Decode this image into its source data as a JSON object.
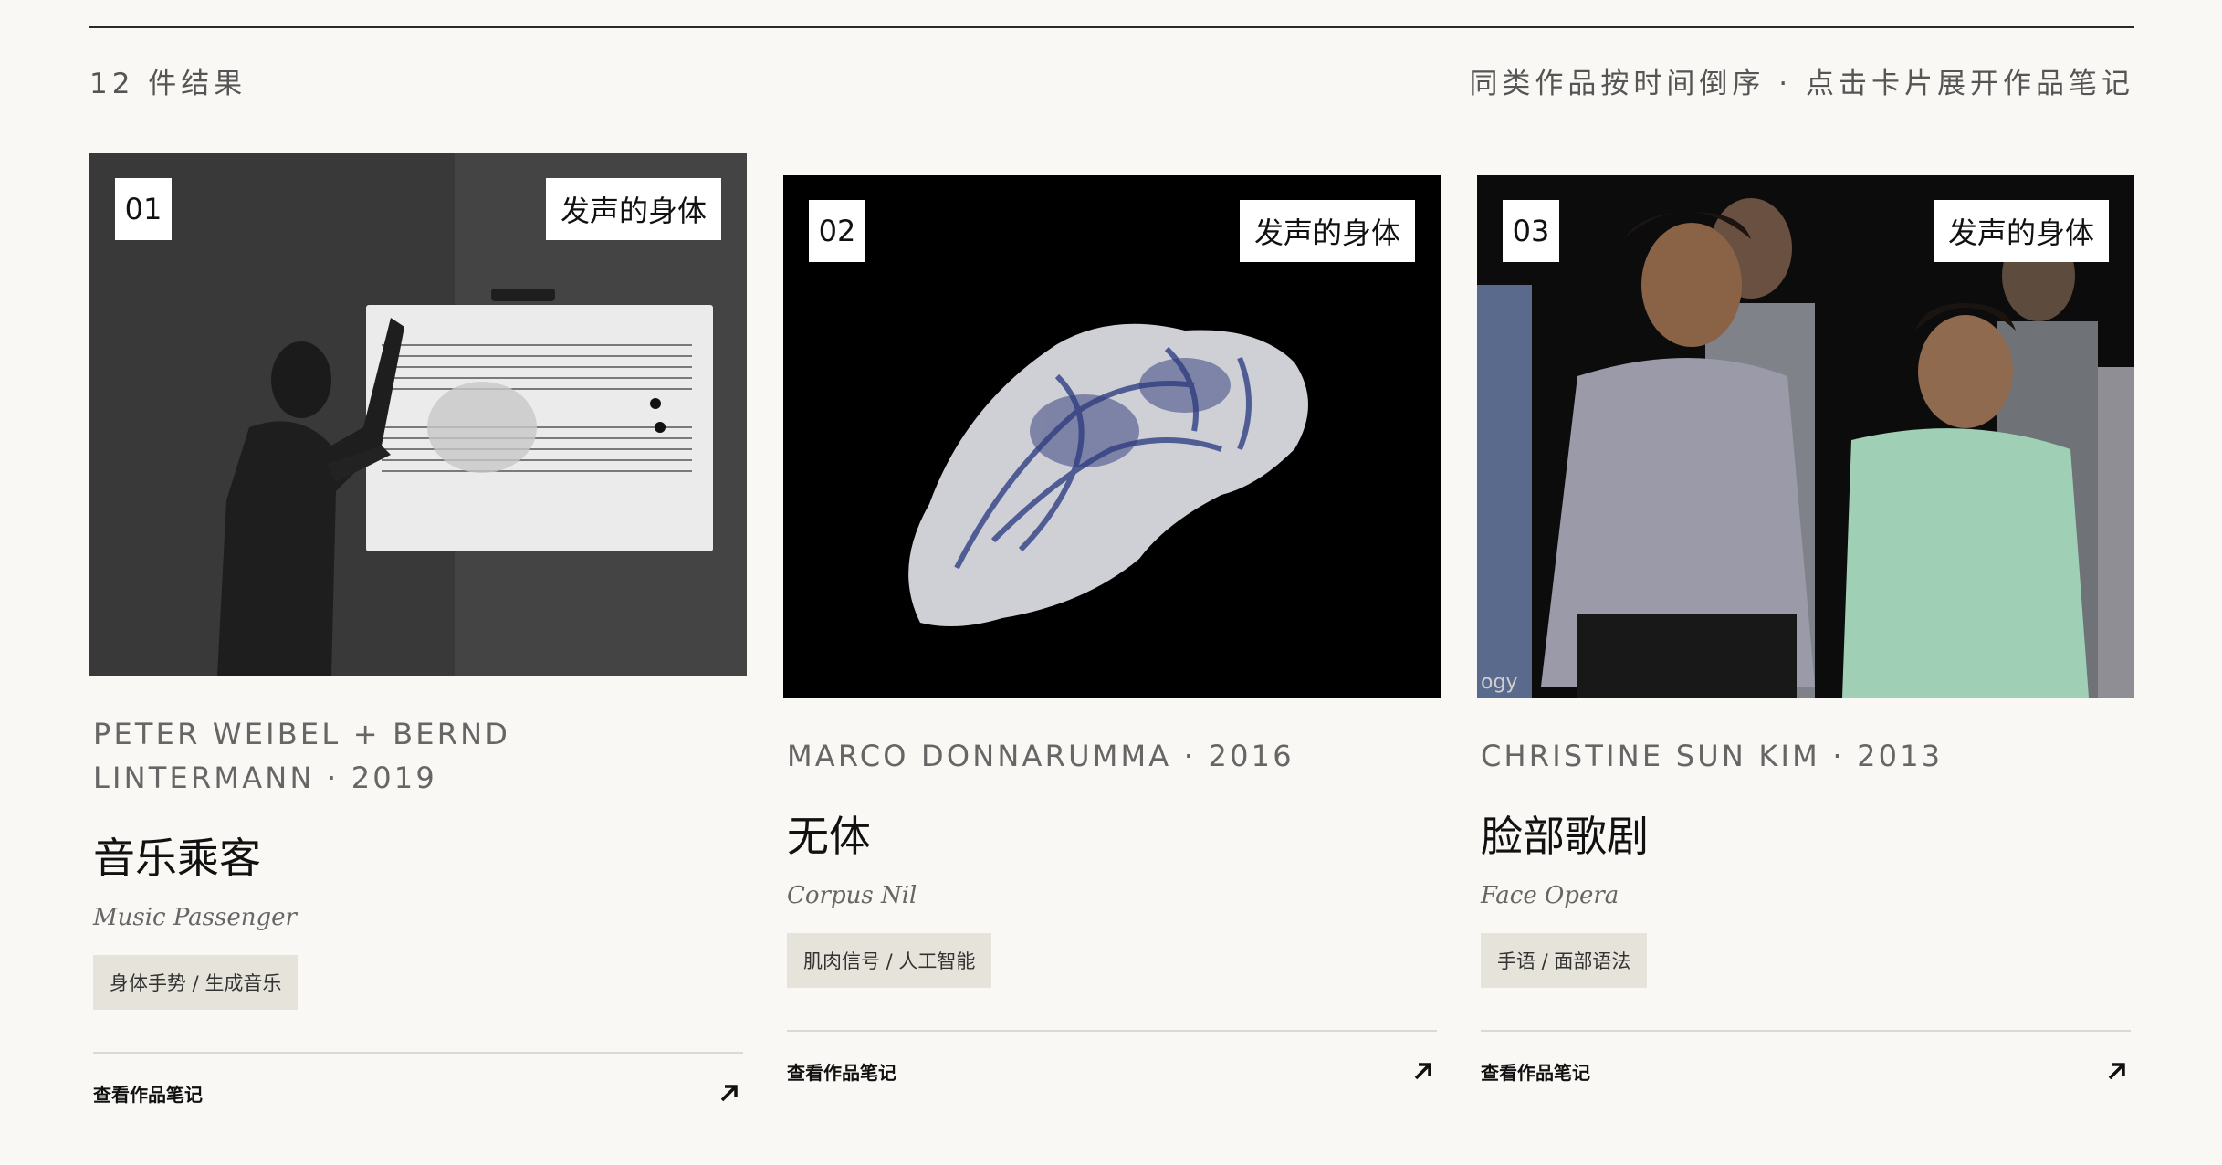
{
  "header": {
    "result_count": "12 件结果",
    "hint": "同类作品按时间倒序 · 点击卡片展开作品笔记"
  },
  "cards": [
    {
      "number": "01",
      "category": "发声的身体",
      "artist_line": "PETER WEIBEL + BERND LINTERMANN · 2019",
      "title": "音乐乘客",
      "title_en": "Music Passenger",
      "keywords": "身体手势 / 生成音乐",
      "cta": "查看作品笔记"
    },
    {
      "number": "02",
      "category": "发声的身体",
      "artist_line": "MARCO DONNARUMMA · 2016",
      "title": "无体",
      "title_en": "Corpus Nil",
      "keywords": "肌肉信号 / 人工智能",
      "cta": "查看作品笔记"
    },
    {
      "number": "03",
      "category": "发声的身体",
      "artist_line": "CHRISTINE SUN KIM · 2013",
      "title": "脸部歌剧",
      "title_en": "Face Opera",
      "keywords": "手语 / 面部语法",
      "cta": "查看作品笔记",
      "image_caption": "ogy"
    }
  ],
  "icons": {
    "card_link": "arrow-up-right-icon"
  },
  "colors": {
    "background": "#f9f8f5",
    "keyword_chip": "#e6e3da",
    "rule": "#2b2b2b"
  }
}
